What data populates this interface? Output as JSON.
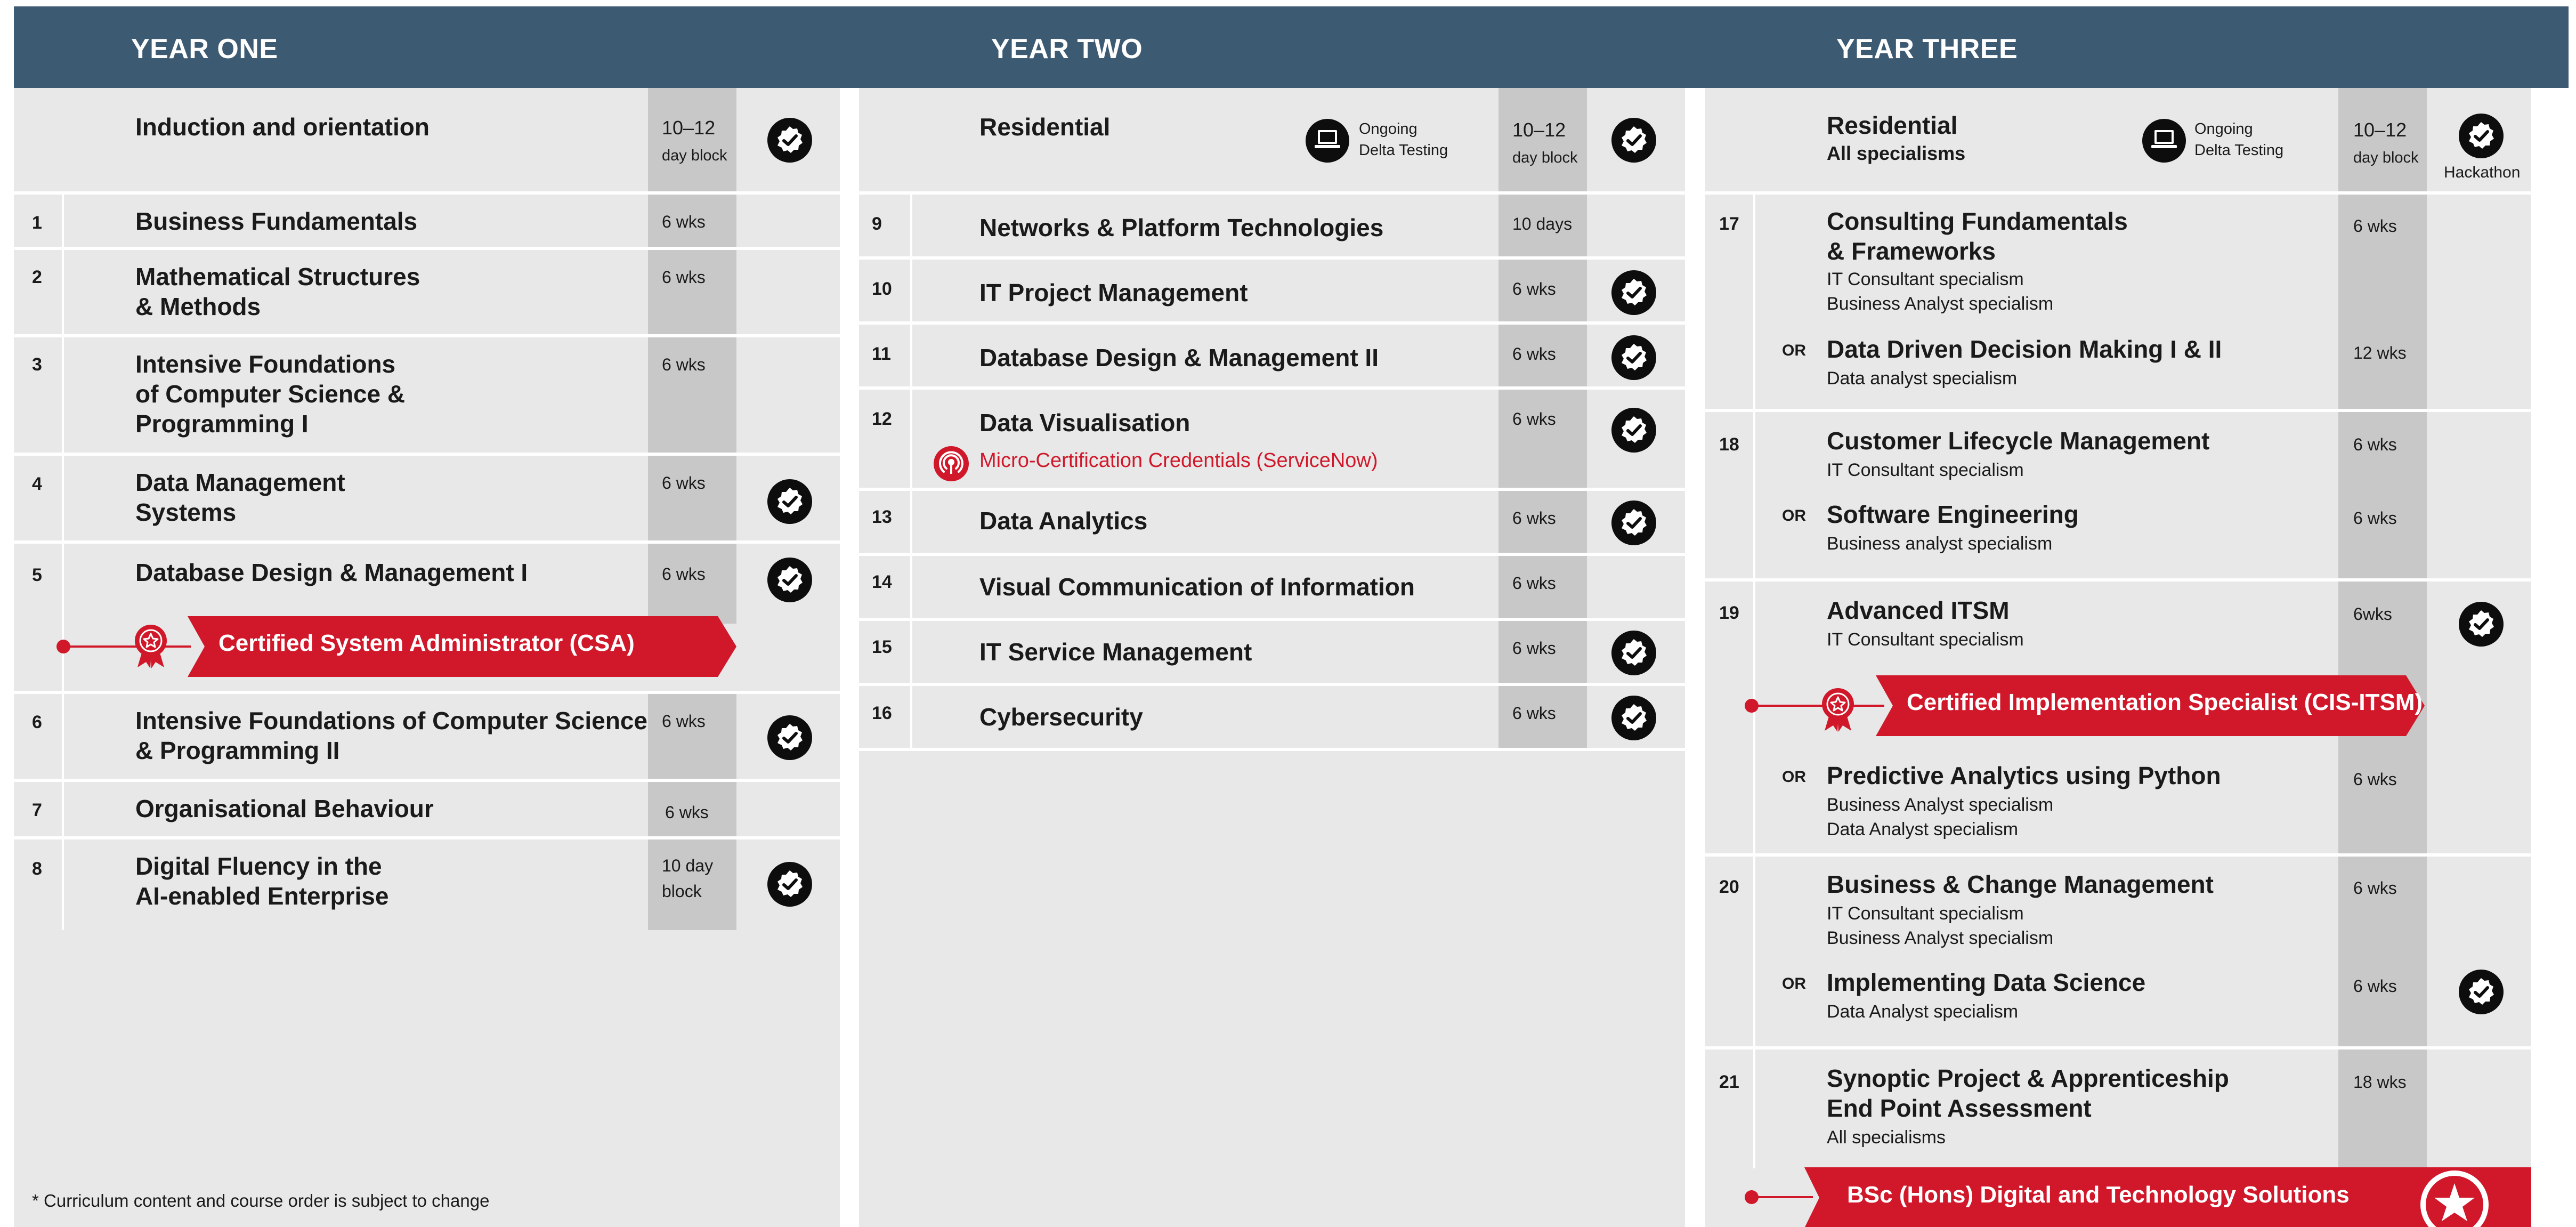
{
  "years": {
    "one": {
      "title": "YEAR ONE",
      "induction": {
        "title": "Induction and orientation",
        "duration_line1": "10–12",
        "duration_line2": "day block"
      },
      "modules": [
        {
          "num": "1",
          "title": "Business Fundamentals",
          "duration": "6 wks"
        },
        {
          "num": "2",
          "title_line1": "Mathematical Structures",
          "title_line2": "& Methods",
          "duration": "6 wks"
        },
        {
          "num": "3",
          "title_line1": "Intensive Foundations",
          "title_line2": "of Computer Science &",
          "title_line3": "Programming I",
          "duration": "6 wks"
        },
        {
          "num": "4",
          "title_line1": "Data Management",
          "title_line2": "Systems",
          "duration": "6 wks"
        },
        {
          "num": "5",
          "title": "Database Design & Management I",
          "duration": "6 wks",
          "certification": "Certified System Administrator (CSA)"
        },
        {
          "num": "6",
          "title_line1": "Intensive Foundations of Computer Science",
          "title_line2": "& Programming II",
          "duration": "6 wks"
        },
        {
          "num": "7",
          "title": "Organisational Behaviour",
          "duration": "6 wks"
        },
        {
          "num": "8",
          "title_line1": "Digital Fluency in the",
          "title_line2": "AI-enabled Enterprise",
          "duration_line1": "10 day",
          "duration_line2": "block"
        }
      ],
      "footnote": "* Curriculum content and course order is subject to change"
    },
    "two": {
      "title": "YEAR TWO",
      "residential": {
        "title": "Residential",
        "ongoing_line1": "Ongoing",
        "ongoing_line2": "Delta Testing",
        "duration_line1": "10–12",
        "duration_line2": "day block"
      },
      "modules": [
        {
          "num": "9",
          "title": "Networks & Platform Technologies",
          "duration": "10 days"
        },
        {
          "num": "10",
          "title": "IT Project Management",
          "duration": "6 wks"
        },
        {
          "num": "11",
          "title": "Database Design & Management II",
          "duration": "6 wks"
        },
        {
          "num": "12",
          "title": "Data Visualisation",
          "duration": "6 wks",
          "micro_cert": "Micro-Certification Credentials (ServiceNow)"
        },
        {
          "num": "13",
          "title": "Data Analytics",
          "duration": "6 wks"
        },
        {
          "num": "14",
          "title": "Visual Communication of Information",
          "duration": "6 wks"
        },
        {
          "num": "15",
          "title": "IT Service Management",
          "duration": "6 wks"
        },
        {
          "num": "16",
          "title": "Cybersecurity",
          "duration": "6 wks"
        }
      ]
    },
    "three": {
      "title": "YEAR THREE",
      "residential": {
        "title": "Residential",
        "subtitle": "All specialisms",
        "ongoing_line1": "Ongoing",
        "ongoing_line2": "Delta Testing",
        "duration_line1": "10–12",
        "duration_line2": "day block",
        "badge_label": "Hackathon"
      },
      "or_label": "OR",
      "modules": [
        {
          "num": "17",
          "title_line1": "Consulting Fundamentals",
          "title_line2": "& Frameworks",
          "sub_line1": "IT Consultant specialism",
          "sub_line2": "Business Analyst specialism",
          "duration": "6 wks",
          "alt_title": "Data Driven Decision Making I & II",
          "alt_sub": "Data analyst specialism",
          "alt_duration": "12 wks"
        },
        {
          "num": "18",
          "title": "Customer Lifecycle Management",
          "sub": "IT Consultant specialism",
          "duration": "6 wks",
          "alt_title": "Software Engineering",
          "alt_sub": "Business analyst specialism",
          "alt_duration": "6 wks"
        },
        {
          "num": "19",
          "title": "Advanced ITSM",
          "sub": "IT Consultant specialism",
          "duration": "6wks",
          "certification": "Certified Implementation Specialist (CIS-ITSM)",
          "alt_title": "Predictive Analytics using Python",
          "alt_sub_line1": "Business Analyst specialism",
          "alt_sub_line2": "Data Analyst specialism",
          "alt_duration": "6 wks"
        },
        {
          "num": "20",
          "title": "Business & Change Management",
          "sub_line1": "IT Consultant specialism",
          "sub_line2": "Business Analyst specialism",
          "duration": "6 wks",
          "alt_title": "Implementing Data Science",
          "alt_sub": "Data Analyst specialism",
          "alt_duration": "6 wks"
        },
        {
          "num": "21",
          "title_line1": "Synoptic Project & Apprenticeship",
          "title_line2": "End Point Assessment",
          "sub": "All specialisms",
          "duration": "18 wks",
          "degree": "BSc (Hons) Digital and Technology Solutions"
        }
      ]
    }
  },
  "colors": {
    "header": "#3d5a73",
    "panel": "#e8e8e8",
    "duration_column": "#c8c8c8",
    "accent_red": "#d0182a",
    "badge": "#0d0d0d"
  },
  "icons": {
    "completion_badge": "check-badge-icon",
    "ongoing": "laptop-icon",
    "certification": "award-rosette-icon",
    "micro_cert": "podcast-icon",
    "degree": "star-icon"
  }
}
